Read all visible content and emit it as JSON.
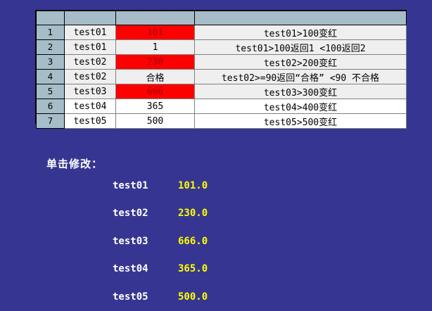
{
  "grid": {
    "header": [
      "",
      "",
      "",
      ""
    ],
    "rows": [
      {
        "num": "1",
        "name": "test01",
        "value": "101",
        "rule": "test01>100变红",
        "bg": "red"
      },
      {
        "num": "2",
        "name": "test01",
        "value": "1",
        "rule": "test01>100返回1 <100返回2",
        "bg": "normal"
      },
      {
        "num": "3",
        "name": "test02",
        "value": "230",
        "rule": "test02>200变红",
        "bg": "red"
      },
      {
        "num": "4",
        "name": "test02",
        "value": "合格",
        "rule": "test02>=90返回“合格” <90 不合格",
        "bg": "normal"
      },
      {
        "num": "5",
        "name": "test03",
        "value": "666",
        "rule": "test03>300变红",
        "bg": "red"
      },
      {
        "num": "6",
        "name": "test04",
        "value": "365",
        "rule": "test04>400变红",
        "bg": "white"
      },
      {
        "num": "7",
        "name": "test05",
        "value": "500",
        "rule": "test05>500变红",
        "bg": "white"
      }
    ],
    "colors": {
      "header_bg": "#a6bcc8",
      "cell_bg": "#efefef",
      "red_bg": "#ff0000",
      "red_text": "#a00000"
    }
  },
  "edit_panel": {
    "title": "单击修改：",
    "items": [
      {
        "name": "test01",
        "value": "101.0"
      },
      {
        "name": "test02",
        "value": "230.0"
      },
      {
        "name": "test03",
        "value": "666.0"
      },
      {
        "name": "test04",
        "value": "365.0"
      },
      {
        "name": "test05",
        "value": "500.0"
      }
    ],
    "colors": {
      "background": "#363692",
      "label": "#ffffff",
      "value": "#ffff00"
    }
  }
}
